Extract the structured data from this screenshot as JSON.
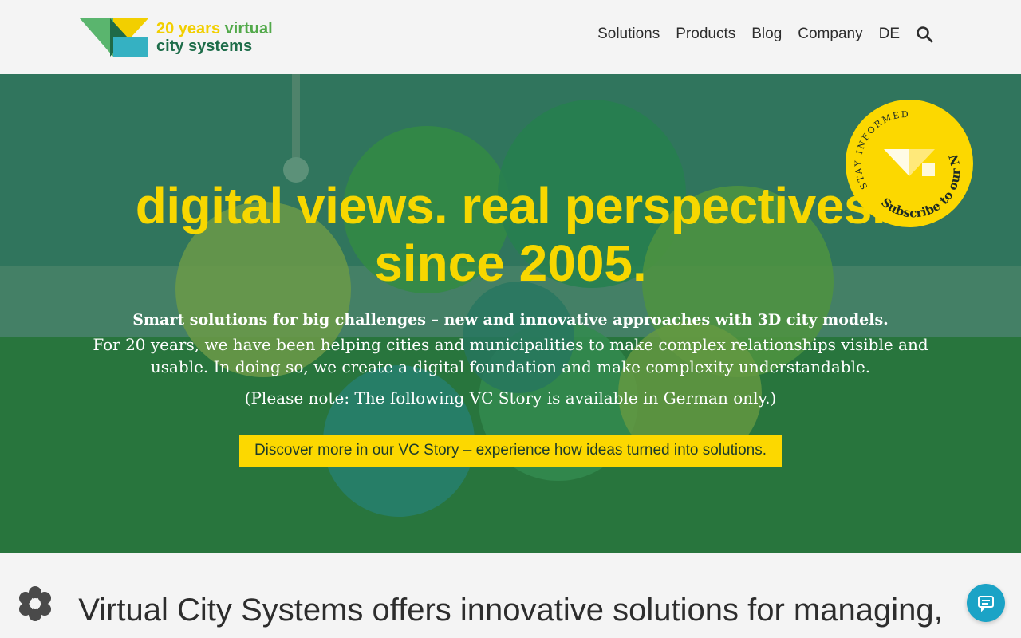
{
  "header": {
    "logo": {
      "line1_years": "20 years",
      "line1_virtual": "virtual",
      "line2": "city systems"
    },
    "nav": [
      "Solutions",
      "Products",
      "Blog",
      "Company",
      "DE"
    ]
  },
  "hero": {
    "headline_1": "digital views. real perspectives.",
    "headline_2": "since 2005.",
    "sub_bold": "Smart solutions for big challenges – new and innovative approaches with 3D city models.",
    "sub_text": "For 20 years, we have been helping cities and municipalities to make complex relationships visible and usable. In doing so, we create a digital foundation and make complexity understandable.",
    "note": "(Please note: The following VC Story is available in German only.)",
    "cta": "Discover more in our VC Story – experience how ideas turned into solutions.",
    "badge": {
      "arc_top": "STAY INFORMED",
      "arc_bottom": "Subscribe to our Newsletter"
    }
  },
  "bottom": {
    "title": "Virtual City Systems offers innovative solutions for managing,"
  },
  "colors": {
    "accent_yellow": "#fcd800",
    "brand_green": "#52a94a",
    "chat_blue": "#1ba3c6"
  }
}
